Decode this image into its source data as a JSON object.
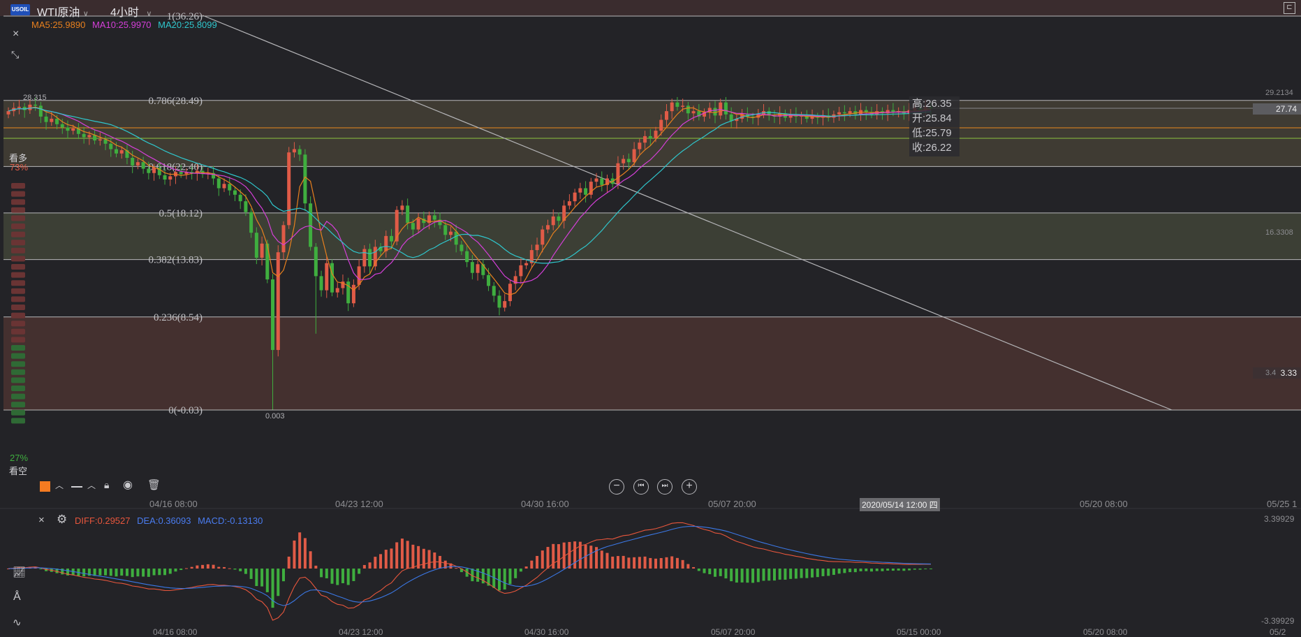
{
  "header": {
    "symbol_badge": "USOIL",
    "symbol": "WTI原油",
    "timeframe": "4小时"
  },
  "ma_legend": [
    {
      "label": "MA5:25.9890",
      "color": "#e8801e"
    },
    {
      "label": "MA10:25.9970",
      "color": "#d43fd8"
    },
    {
      "label": "MA20:25.8099",
      "color": "#2fc6cc"
    }
  ],
  "macd_legend": [
    {
      "label": "DIFF:0.29527",
      "color": "#e8563c"
    },
    {
      "label": "DEA:0.36093",
      "color": "#3b78e6"
    },
    {
      "label": "MACD:-0.13130",
      "color": "#4a7cf0"
    }
  ],
  "sentiment": {
    "bull_label": "看多",
    "bull_pct": "73%",
    "bear_label": "看空",
    "bear_pct": "27%"
  },
  "tooltip": {
    "high": "高:26.35",
    "open": "开:25.84",
    "low": "低:25.79",
    "close": "收:26.22"
  },
  "price_tags": {
    "current": "27.74",
    "lower": "3.33"
  },
  "right_scale": [
    "29.2134",
    "16.3308",
    "3.4"
  ],
  "macd_scale": {
    "top": "3.39929",
    "bottom": "-3.39929"
  },
  "extreme_labels": {
    "high": "28.315",
    "low": "0.003"
  },
  "time_labels": [
    "04/16 08:00",
    "04/23 12:00",
    "04/30 16:00",
    "05/07 20:00",
    "05/20 08:00",
    "05/25 1"
  ],
  "cursor_time": "2020/05/14 12:00 四",
  "bottom_time_labels": [
    "04/16 08:00",
    "04/23 12:00",
    "04/30 16:00",
    "05/07 20:00",
    "05/15 00:00",
    "05/20 08:00",
    "05/2"
  ],
  "colors": {
    "up": "#e05b47",
    "down": "#3fae3f",
    "bg": "#232327"
  },
  "chart_data": [
    {
      "type": "candlestick",
      "ylim": [
        -0.03,
        36.26
      ],
      "fib_levels": [
        {
          "label": "1(36.26)",
          "value": 36.26
        },
        {
          "label": "0.786(28.49)",
          "value": 28.49
        },
        {
          "label": "0.618(22.40)",
          "value": 22.4
        },
        {
          "label": "0.5(18.12)",
          "value": 18.12
        },
        {
          "label": "0.382(13.83)",
          "value": 13.83
        },
        {
          "label": "0.236(8.54)",
          "value": 8.54
        },
        {
          "label": "0(-0.03)",
          "value": -0.03
        }
      ],
      "close": [
        27.5,
        27.8,
        27.9,
        27.6,
        28.1,
        28.0,
        27.0,
        26.5,
        26.8,
        26.3,
        26.0,
        25.7,
        25.9,
        25.4,
        25.1,
        25.3,
        24.8,
        24.9,
        24.5,
        24.0,
        23.6,
        23.9,
        23.2,
        22.5,
        22.8,
        22.2,
        21.8,
        22.3,
        21.6,
        21.2,
        21.5,
        21.9,
        21.7,
        21.9,
        21.8,
        22.0,
        21.7,
        21.8,
        21.3,
        20.4,
        20.8,
        20.2,
        19.8,
        19.2,
        18.2,
        16.3,
        14.0,
        15.3,
        12.0,
        5.5,
        14.5,
        17.0,
        23.7,
        24.0,
        23.5,
        19.0,
        15.0,
        12.3,
        11.0,
        13.5,
        10.8,
        11.2,
        11.8,
        9.8,
        11.5,
        13.2,
        14.8,
        13.2,
        15.0,
        14.6,
        16.0,
        15.5,
        18.4,
        18.8,
        17.2,
        16.6,
        17.6,
        17.2,
        17.9,
        17.5,
        17.0,
        16.1,
        16.4,
        15.2,
        14.6,
        13.6,
        12.6,
        13.4,
        12.4,
        11.4,
        10.5,
        9.4,
        10.0,
        11.6,
        12.3,
        13.3,
        13.5,
        14.7,
        15.2,
        16.6,
        17.0,
        17.8,
        17.4,
        18.8,
        19.2,
        20.0,
        20.4,
        19.8,
        21.0,
        21.3,
        20.7,
        21.3,
        20.8,
        22.7,
        23.1,
        22.8,
        24.0,
        24.6,
        25.2,
        25.0,
        25.7,
        26.7,
        27.5,
        28.3,
        27.9,
        28.0,
        27.3,
        27.5,
        27.0,
        27.4,
        27.8,
        27.1,
        28.3,
        27.2,
        26.6,
        26.8,
        27.2,
        27.0,
        26.9,
        27.2,
        27.5,
        27.1,
        27.0,
        27.3,
        26.9,
        27.2,
        27.0,
        27.1,
        26.8,
        27.0,
        26.9,
        27.1,
        26.9,
        27.2,
        27.4,
        27.3,
        27.5,
        27.2,
        27.6,
        27.4,
        27.2,
        27.5,
        27.3,
        27.6,
        27.4,
        27.5,
        27.3,
        27.6,
        27.8,
        27.6,
        27.9,
        27.74
      ]
    },
    {
      "type": "macd",
      "ylim": [
        -3.39929,
        3.39929
      ]
    }
  ]
}
